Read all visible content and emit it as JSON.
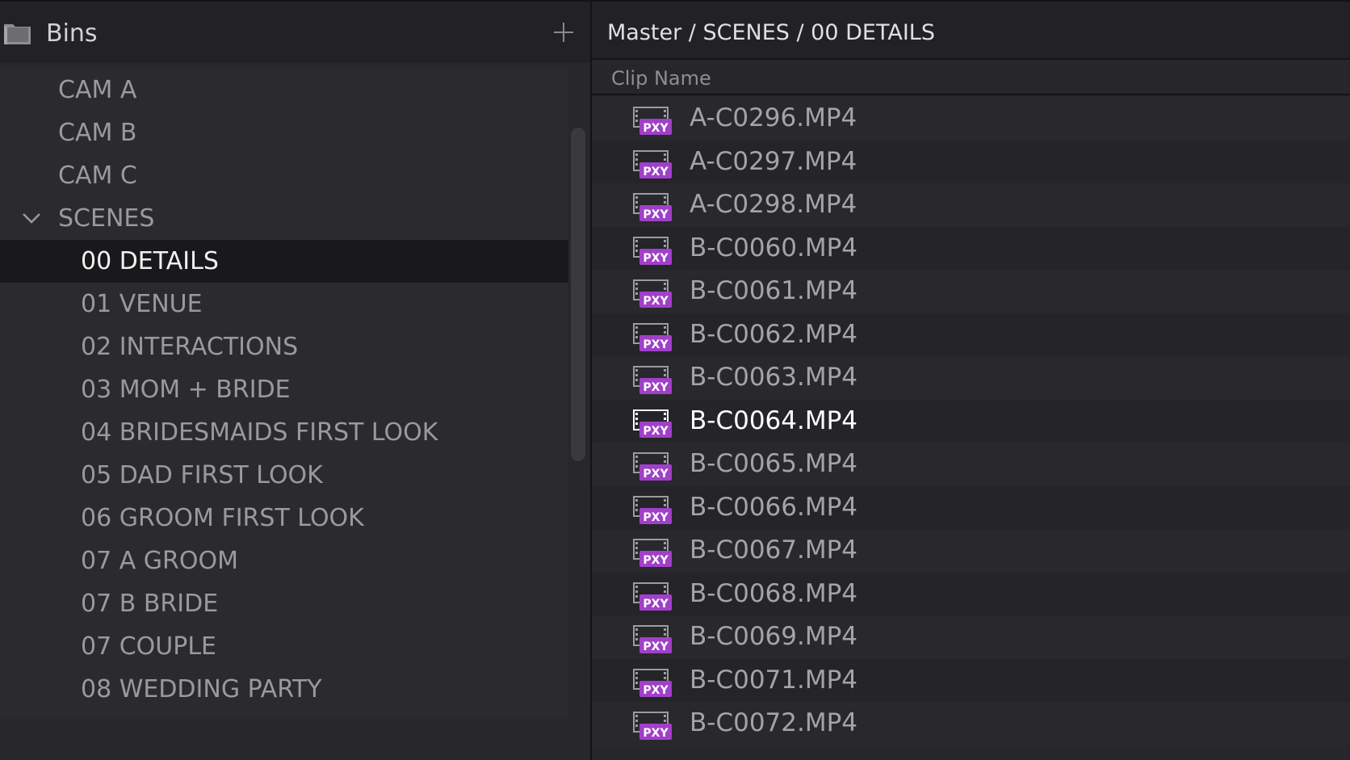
{
  "bins_panel": {
    "title": "Bins",
    "folder_icon": "folder-icon",
    "add_icon": "plus-icon"
  },
  "bins": [
    {
      "label": "CAM A",
      "level": 0
    },
    {
      "label": "CAM B",
      "level": 0
    },
    {
      "label": "CAM C",
      "level": 0
    },
    {
      "label": "SCENES",
      "level": 0,
      "expanded": true
    },
    {
      "label": "00 DETAILS",
      "level": 1,
      "selected": true
    },
    {
      "label": "01 VENUE",
      "level": 1
    },
    {
      "label": "02 INTERACTIONS",
      "level": 1
    },
    {
      "label": "03 MOM + BRIDE",
      "level": 1
    },
    {
      "label": "04 BRIDESMAIDS FIRST LOOK",
      "level": 1
    },
    {
      "label": "05 DAD FIRST LOOK",
      "level": 1
    },
    {
      "label": "06 GROOM FIRST LOOK",
      "level": 1
    },
    {
      "label": "07 A GROOM",
      "level": 1
    },
    {
      "label": "07 B BRIDE",
      "level": 1
    },
    {
      "label": "07 COUPLE",
      "level": 1
    },
    {
      "label": "08 WEDDING PARTY",
      "level": 1
    }
  ],
  "clips_panel": {
    "breadcrumb": "Master / SCENES / 00 DETAILS",
    "column_clip_name": "Clip Name",
    "proxy_badge": "PXY"
  },
  "clips": [
    {
      "name": "A-C0296.MP4"
    },
    {
      "name": "A-C0297.MP4"
    },
    {
      "name": "A-C0298.MP4"
    },
    {
      "name": "B-C0060.MP4"
    },
    {
      "name": "B-C0061.MP4"
    },
    {
      "name": "B-C0062.MP4"
    },
    {
      "name": "B-C0063.MP4"
    },
    {
      "name": "B-C0064.MP4",
      "active": true
    },
    {
      "name": "B-C0065.MP4"
    },
    {
      "name": "B-C0066.MP4"
    },
    {
      "name": "B-C0067.MP4"
    },
    {
      "name": "B-C0068.MP4"
    },
    {
      "name": "B-C0069.MP4"
    },
    {
      "name": "B-C0071.MP4"
    },
    {
      "name": "B-C0072.MP4"
    }
  ],
  "colors": {
    "proxy_badge": "#a040c8",
    "selected_bin_bg": "#19191c",
    "panel_bg": "#27272c"
  }
}
